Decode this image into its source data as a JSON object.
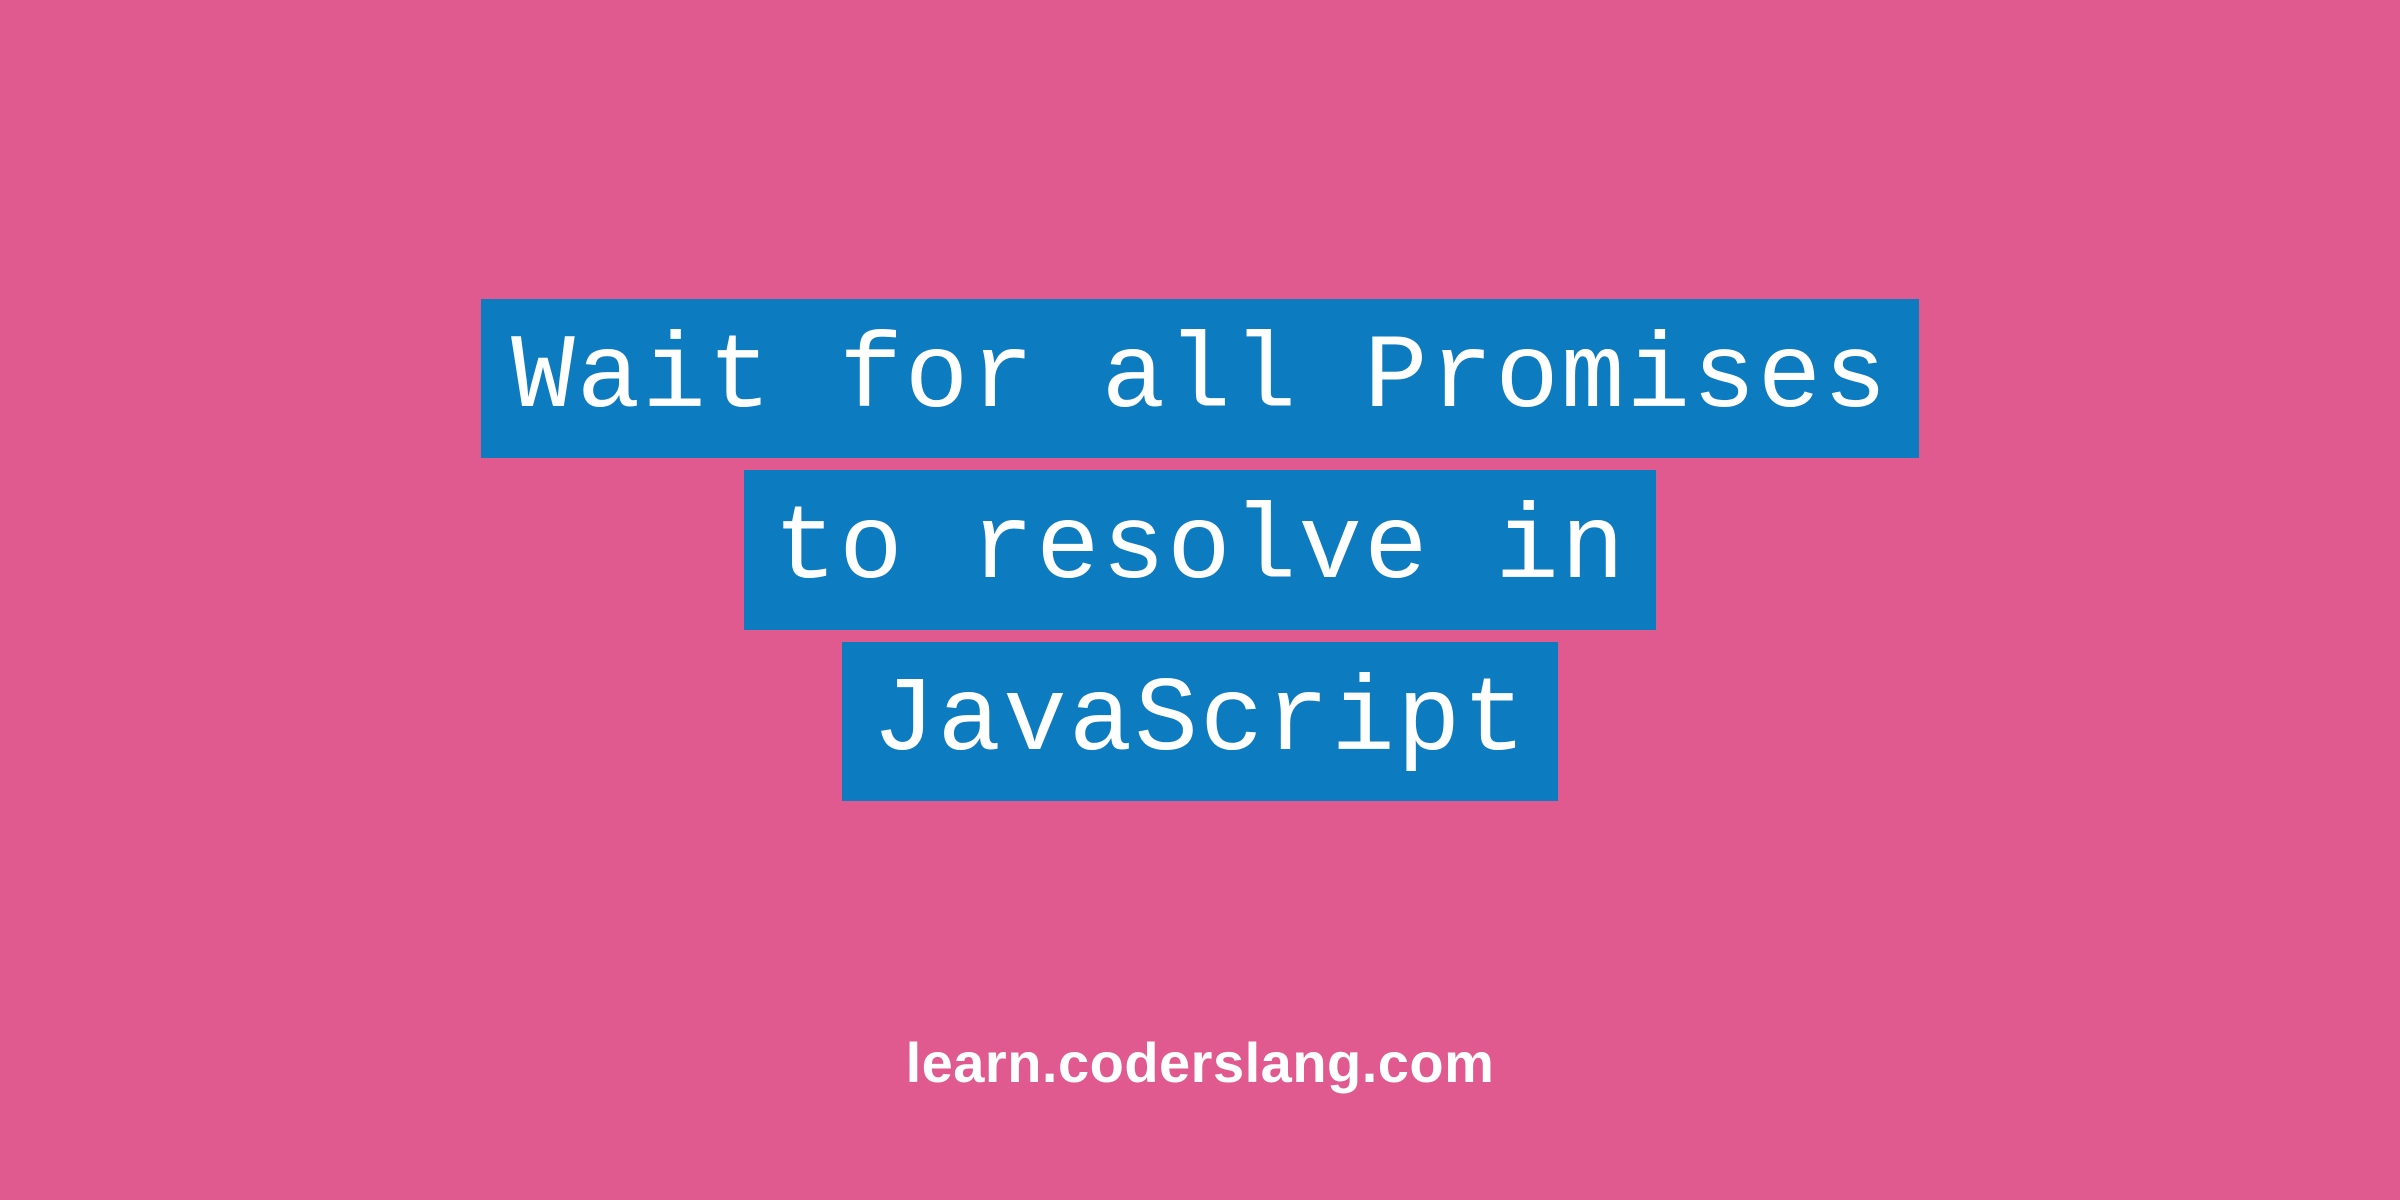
{
  "title": {
    "line1": "Wait for all Promises",
    "line2": "to resolve in",
    "line3": "JavaScript"
  },
  "footer": "learn.coderslang.com",
  "colors": {
    "background": "#e05a8f",
    "highlight": "#0d7bbf",
    "text": "#ffffff"
  }
}
